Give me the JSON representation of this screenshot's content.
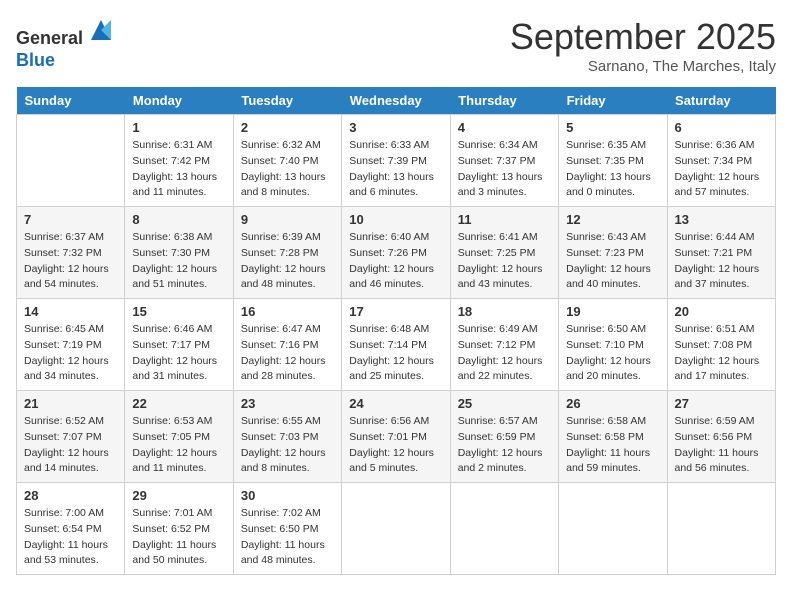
{
  "header": {
    "logo_line1": "General",
    "logo_line2": "Blue",
    "month_title": "September 2025",
    "subtitle": "Sarnano, The Marches, Italy"
  },
  "days_of_week": [
    "Sunday",
    "Monday",
    "Tuesday",
    "Wednesday",
    "Thursday",
    "Friday",
    "Saturday"
  ],
  "weeks": [
    [
      {
        "day": "",
        "sunrise": "",
        "sunset": "",
        "daylight": ""
      },
      {
        "day": "1",
        "sunrise": "Sunrise: 6:31 AM",
        "sunset": "Sunset: 7:42 PM",
        "daylight": "Daylight: 13 hours and 11 minutes."
      },
      {
        "day": "2",
        "sunrise": "Sunrise: 6:32 AM",
        "sunset": "Sunset: 7:40 PM",
        "daylight": "Daylight: 13 hours and 8 minutes."
      },
      {
        "day": "3",
        "sunrise": "Sunrise: 6:33 AM",
        "sunset": "Sunset: 7:39 PM",
        "daylight": "Daylight: 13 hours and 6 minutes."
      },
      {
        "day": "4",
        "sunrise": "Sunrise: 6:34 AM",
        "sunset": "Sunset: 7:37 PM",
        "daylight": "Daylight: 13 hours and 3 minutes."
      },
      {
        "day": "5",
        "sunrise": "Sunrise: 6:35 AM",
        "sunset": "Sunset: 7:35 PM",
        "daylight": "Daylight: 13 hours and 0 minutes."
      },
      {
        "day": "6",
        "sunrise": "Sunrise: 6:36 AM",
        "sunset": "Sunset: 7:34 PM",
        "daylight": "Daylight: 12 hours and 57 minutes."
      }
    ],
    [
      {
        "day": "7",
        "sunrise": "Sunrise: 6:37 AM",
        "sunset": "Sunset: 7:32 PM",
        "daylight": "Daylight: 12 hours and 54 minutes."
      },
      {
        "day": "8",
        "sunrise": "Sunrise: 6:38 AM",
        "sunset": "Sunset: 7:30 PM",
        "daylight": "Daylight: 12 hours and 51 minutes."
      },
      {
        "day": "9",
        "sunrise": "Sunrise: 6:39 AM",
        "sunset": "Sunset: 7:28 PM",
        "daylight": "Daylight: 12 hours and 48 minutes."
      },
      {
        "day": "10",
        "sunrise": "Sunrise: 6:40 AM",
        "sunset": "Sunset: 7:26 PM",
        "daylight": "Daylight: 12 hours and 46 minutes."
      },
      {
        "day": "11",
        "sunrise": "Sunrise: 6:41 AM",
        "sunset": "Sunset: 7:25 PM",
        "daylight": "Daylight: 12 hours and 43 minutes."
      },
      {
        "day": "12",
        "sunrise": "Sunrise: 6:43 AM",
        "sunset": "Sunset: 7:23 PM",
        "daylight": "Daylight: 12 hours and 40 minutes."
      },
      {
        "day": "13",
        "sunrise": "Sunrise: 6:44 AM",
        "sunset": "Sunset: 7:21 PM",
        "daylight": "Daylight: 12 hours and 37 minutes."
      }
    ],
    [
      {
        "day": "14",
        "sunrise": "Sunrise: 6:45 AM",
        "sunset": "Sunset: 7:19 PM",
        "daylight": "Daylight: 12 hours and 34 minutes."
      },
      {
        "day": "15",
        "sunrise": "Sunrise: 6:46 AM",
        "sunset": "Sunset: 7:17 PM",
        "daylight": "Daylight: 12 hours and 31 minutes."
      },
      {
        "day": "16",
        "sunrise": "Sunrise: 6:47 AM",
        "sunset": "Sunset: 7:16 PM",
        "daylight": "Daylight: 12 hours and 28 minutes."
      },
      {
        "day": "17",
        "sunrise": "Sunrise: 6:48 AM",
        "sunset": "Sunset: 7:14 PM",
        "daylight": "Daylight: 12 hours and 25 minutes."
      },
      {
        "day": "18",
        "sunrise": "Sunrise: 6:49 AM",
        "sunset": "Sunset: 7:12 PM",
        "daylight": "Daylight: 12 hours and 22 minutes."
      },
      {
        "day": "19",
        "sunrise": "Sunrise: 6:50 AM",
        "sunset": "Sunset: 7:10 PM",
        "daylight": "Daylight: 12 hours and 20 minutes."
      },
      {
        "day": "20",
        "sunrise": "Sunrise: 6:51 AM",
        "sunset": "Sunset: 7:08 PM",
        "daylight": "Daylight: 12 hours and 17 minutes."
      }
    ],
    [
      {
        "day": "21",
        "sunrise": "Sunrise: 6:52 AM",
        "sunset": "Sunset: 7:07 PM",
        "daylight": "Daylight: 12 hours and 14 minutes."
      },
      {
        "day": "22",
        "sunrise": "Sunrise: 6:53 AM",
        "sunset": "Sunset: 7:05 PM",
        "daylight": "Daylight: 12 hours and 11 minutes."
      },
      {
        "day": "23",
        "sunrise": "Sunrise: 6:55 AM",
        "sunset": "Sunset: 7:03 PM",
        "daylight": "Daylight: 12 hours and 8 minutes."
      },
      {
        "day": "24",
        "sunrise": "Sunrise: 6:56 AM",
        "sunset": "Sunset: 7:01 PM",
        "daylight": "Daylight: 12 hours and 5 minutes."
      },
      {
        "day": "25",
        "sunrise": "Sunrise: 6:57 AM",
        "sunset": "Sunset: 6:59 PM",
        "daylight": "Daylight: 12 hours and 2 minutes."
      },
      {
        "day": "26",
        "sunrise": "Sunrise: 6:58 AM",
        "sunset": "Sunset: 6:58 PM",
        "daylight": "Daylight: 11 hours and 59 minutes."
      },
      {
        "day": "27",
        "sunrise": "Sunrise: 6:59 AM",
        "sunset": "Sunset: 6:56 PM",
        "daylight": "Daylight: 11 hours and 56 minutes."
      }
    ],
    [
      {
        "day": "28",
        "sunrise": "Sunrise: 7:00 AM",
        "sunset": "Sunset: 6:54 PM",
        "daylight": "Daylight: 11 hours and 53 minutes."
      },
      {
        "day": "29",
        "sunrise": "Sunrise: 7:01 AM",
        "sunset": "Sunset: 6:52 PM",
        "daylight": "Daylight: 11 hours and 50 minutes."
      },
      {
        "day": "30",
        "sunrise": "Sunrise: 7:02 AM",
        "sunset": "Sunset: 6:50 PM",
        "daylight": "Daylight: 11 hours and 48 minutes."
      },
      {
        "day": "",
        "sunrise": "",
        "sunset": "",
        "daylight": ""
      },
      {
        "day": "",
        "sunrise": "",
        "sunset": "",
        "daylight": ""
      },
      {
        "day": "",
        "sunrise": "",
        "sunset": "",
        "daylight": ""
      },
      {
        "day": "",
        "sunrise": "",
        "sunset": "",
        "daylight": ""
      }
    ]
  ]
}
